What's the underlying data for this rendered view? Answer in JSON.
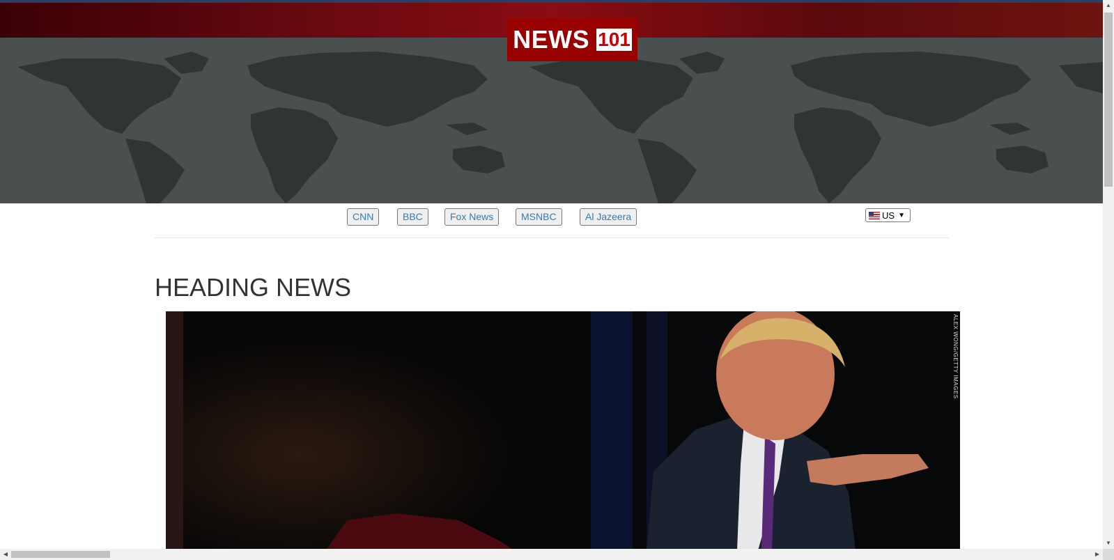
{
  "header": {
    "logo_word": "NEWS",
    "logo_number": "101",
    "colors": {
      "banner_red": "#8a0c14",
      "logo_bg": "#990000",
      "map_land": "#2f3434",
      "map_sea": "#4a5050"
    }
  },
  "nav": {
    "sources": [
      {
        "label": "CNN"
      },
      {
        "label": "BBC"
      },
      {
        "label": "Fox News"
      },
      {
        "label": "MSNBC"
      },
      {
        "label": "Al Jazeera"
      }
    ],
    "region_select": {
      "value": "US",
      "flag_icon": "us-flag-icon"
    },
    "link_color": "#337ab7"
  },
  "main": {
    "heading": "HEADING NEWS",
    "photo": {
      "icon": "news-photo",
      "credit": "ALEX WONG/GETTY IMAGES"
    }
  }
}
